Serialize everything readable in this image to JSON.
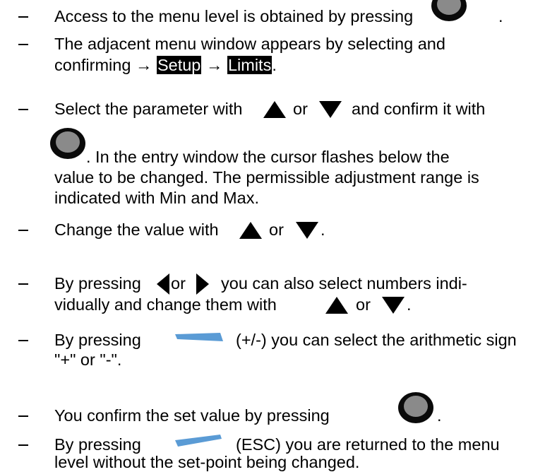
{
  "instructions": [
    {
      "lines": [
        "Access to the menu level is obtained by pressing",
        "."
      ]
    },
    {
      "lines": [
        "The adjacent menu window appears by selecting and",
        "confirming →",
        "→",
        "."
      ],
      "highlights": [
        "Setup",
        "Limits"
      ]
    },
    {
      "lines": [
        "Select the parameter with",
        "or",
        "and confirm it with",
        ". In the entry window the cursor flashes below the",
        "value to be changed. The permissible adjustment range is",
        "indicated with Min and Max."
      ]
    },
    {
      "lines": [
        "Change the value with",
        "or",
        "."
      ]
    },
    {
      "lines": [
        "By pressing",
        "or",
        "you can also select numbers indi-",
        "vidually and change them with",
        "or",
        "."
      ]
    },
    {
      "lines": [
        "By pressing",
        "(+/-) you can select the arithmetic sign",
        "\"+\" or \"-\"."
      ]
    },
    {
      "lines": [
        "You confirm the set value by pressing",
        "."
      ]
    },
    {
      "lines": [
        "By pressing",
        "(ESC) you are returned to the menu",
        "level without the set-point being changed."
      ]
    }
  ],
  "icons": {
    "dial": "dial-button-icon",
    "up": "up-arrow-icon",
    "down": "down-arrow-icon",
    "left": "left-arrow-icon",
    "right": "right-arrow-icon",
    "sign_key": "sign-softkey-icon",
    "esc_key": "esc-softkey-icon"
  },
  "colors": {
    "dial_outer": "#0a0a0a",
    "dial_inner": "#8a8a8a",
    "softkey_blue": "#5a9bd5"
  }
}
